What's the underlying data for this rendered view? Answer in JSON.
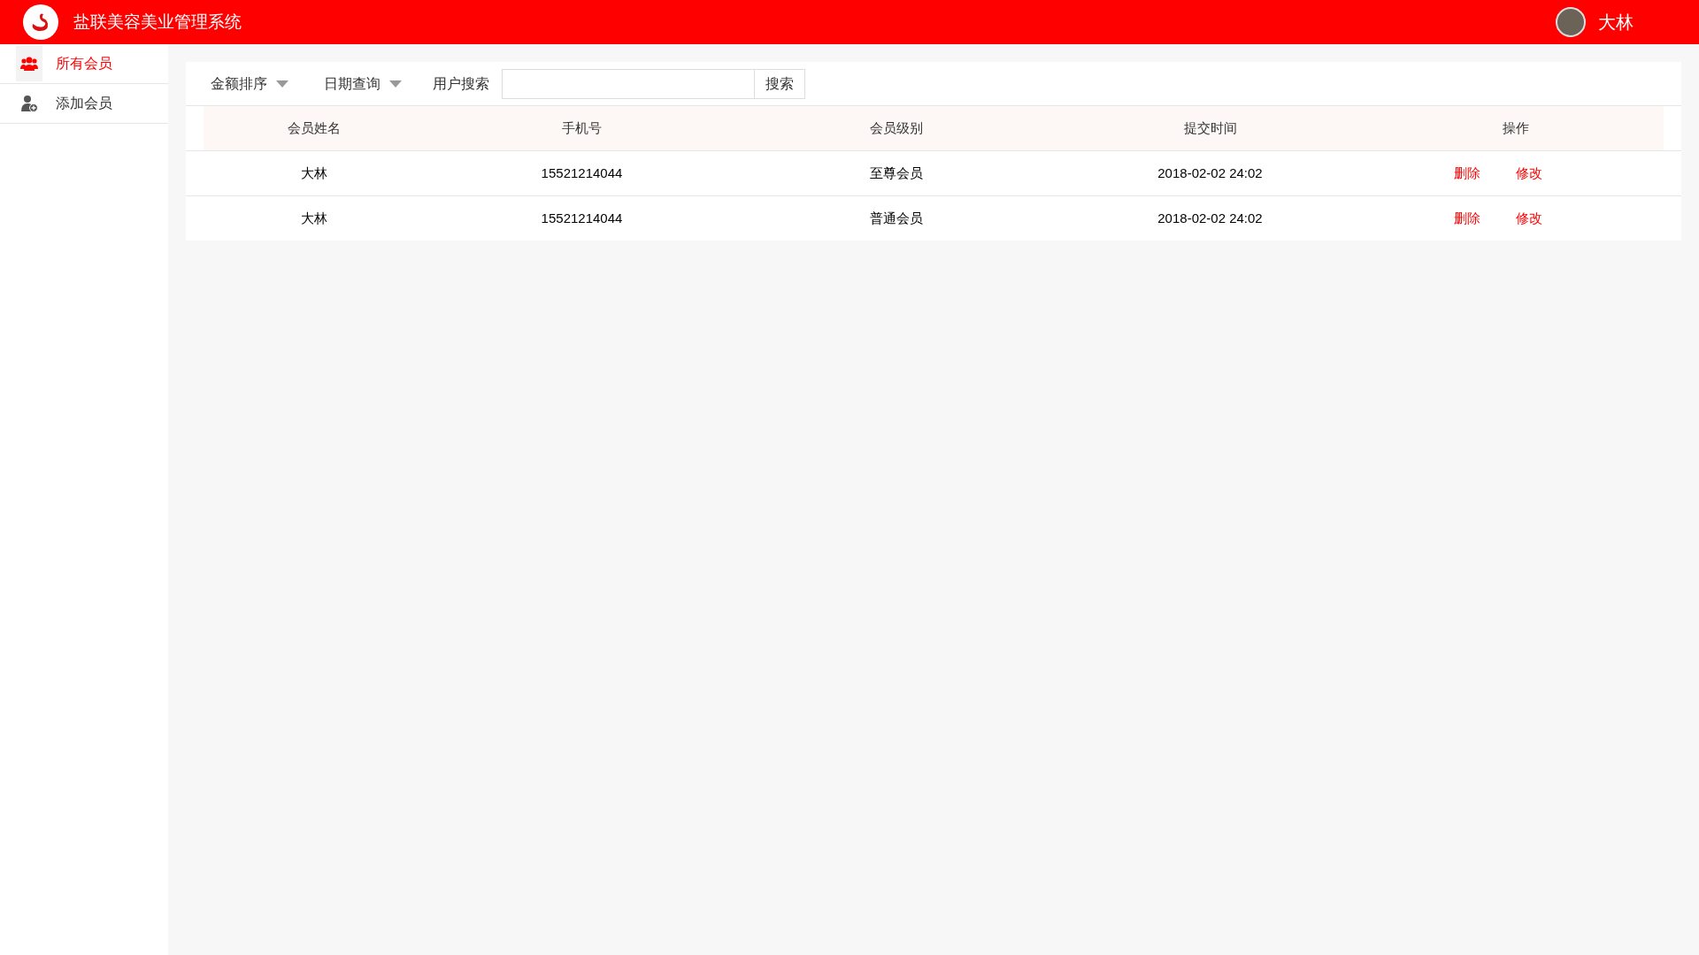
{
  "header": {
    "title": "盐联美容美业管理系统",
    "user": "大林"
  },
  "sidebar": {
    "items": [
      {
        "label": "所有会员",
        "selected": true,
        "kind": "group"
      },
      {
        "label": "添加会员",
        "selected": false,
        "kind": "add"
      }
    ]
  },
  "toolbar": {
    "sort_amount": "金额排序",
    "date_query": "日期查询",
    "search_label": "用户搜索",
    "search_button": "搜索"
  },
  "table": {
    "columns": [
      "会员姓名",
      "手机号",
      "会员级别",
      "提交时间",
      "操作"
    ],
    "rows": [
      {
        "name": "大林",
        "phone": "15521214044",
        "level": "至尊会员",
        "time": "2018-02-02 24:02",
        "actions": [
          "删除",
          "修改"
        ]
      },
      {
        "name": "大林",
        "phone": "15521214044",
        "level": "普通会员",
        "time": "2018-02-02 24:02",
        "actions": [
          "删除",
          "修改"
        ]
      }
    ]
  }
}
